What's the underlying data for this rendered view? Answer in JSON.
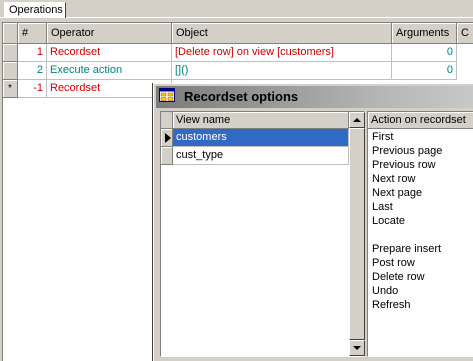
{
  "tabs": [
    {
      "label": "Operations"
    }
  ],
  "grid": {
    "headers": [
      "#",
      "Operator",
      "Object",
      "Arguments",
      "C"
    ],
    "rows": [
      {
        "indicator": "",
        "num": "1",
        "operator": "Recordset",
        "object": "[Delete row] on view [customers]",
        "arguments": "0"
      },
      {
        "indicator": "",
        "num": "2",
        "operator": "Execute action",
        "object": "[]()",
        "arguments": "0"
      },
      {
        "indicator": "*",
        "num": "-1",
        "operator": "Recordset",
        "object": "",
        "arguments": ""
      }
    ]
  },
  "dialog": {
    "title": "Recordset options",
    "view_list": {
      "header": "View name",
      "items": [
        "customers",
        "cust_type"
      ],
      "selected_index": 0
    },
    "action_list": {
      "header": "Action on recordset",
      "items": [
        "First",
        "Previous page",
        "Previous row",
        "Next row",
        "Next page",
        "Last",
        "Locate",
        "",
        "Prepare insert",
        "Post row",
        "Delete row",
        "Undo",
        "Refresh"
      ]
    }
  }
}
